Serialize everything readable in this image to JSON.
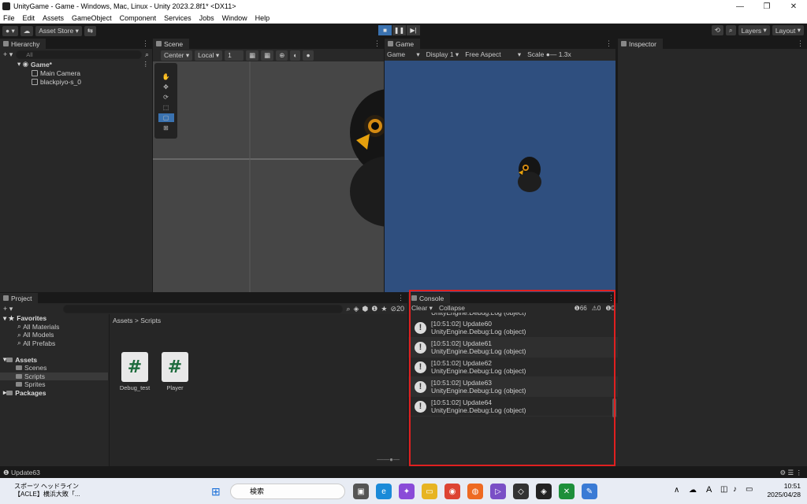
{
  "window": {
    "title": "UnityGame - Game - Windows, Mac, Linux - Unity 2023.2.8f1* <DX11>",
    "minimize": "—",
    "maximize": "❐",
    "close": "✕"
  },
  "menu": [
    "File",
    "Edit",
    "Assets",
    "GameObject",
    "Component",
    "Services",
    "Jobs",
    "Window",
    "Help"
  ],
  "toolbar": {
    "asset_store": "Asset Store ▾",
    "layers": "Layers",
    "layout": "Layout"
  },
  "hierarchy": {
    "tab": "Hierarchy",
    "search_placeholder": "All",
    "scene": "Game*",
    "objects": [
      "Main Camera",
      "blackpiyo-s_0"
    ]
  },
  "scene": {
    "tab": "Scene",
    "pivot": "Center",
    "space": "Local",
    "value": "1"
  },
  "game": {
    "tab": "Game",
    "mode": "Game",
    "display": "Display 1",
    "aspect": "Free Aspect",
    "scale_label": "Scale",
    "scale_value": "1.3x"
  },
  "inspector": {
    "tab": "Inspector"
  },
  "project": {
    "tab": "Project",
    "count": "20",
    "favorites": {
      "label": "Favorites",
      "items": [
        "All Materials",
        "All Models",
        "All Prefabs"
      ]
    },
    "assets": {
      "label": "Assets",
      "items": [
        "Scenes",
        "Scripts",
        "Sprites"
      ]
    },
    "packages": "Packages",
    "breadcrumb": "Assets > Scripts",
    "files": [
      "Debug_test",
      "Player"
    ]
  },
  "console": {
    "tab": "Console",
    "clear": "Clear",
    "collapse": "Collapse",
    "counts": {
      "log": "66",
      "warn": "0",
      "error": "0"
    },
    "partial": "UnityEngine.Debug:Log (object)",
    "logs": [
      {
        "msg": "[10:51:02] Update60",
        "src": "UnityEngine.Debug:Log (object)"
      },
      {
        "msg": "[10:51:02] Update61",
        "src": "UnityEngine.Debug:Log (object)"
      },
      {
        "msg": "[10:51:02] Update62",
        "src": "UnityEngine.Debug:Log (object)"
      },
      {
        "msg": "[10:51:02] Update63",
        "src": "UnityEngine.Debug:Log (object)"
      },
      {
        "msg": "[10:51:02] Update64",
        "src": "UnityEngine.Debug:Log (object)"
      }
    ]
  },
  "status": "Update63",
  "taskbar": {
    "news_title": "スポーツ ヘッドライン",
    "news_sub": "【ACLE】横浜大敗「...",
    "search": "検索",
    "ime": "A",
    "time": "10:51",
    "date": "2025/04/28"
  },
  "colors": {
    "highlight": "#e02020",
    "game_bg": "#2f4f7f",
    "accent": "#3a72b0"
  }
}
